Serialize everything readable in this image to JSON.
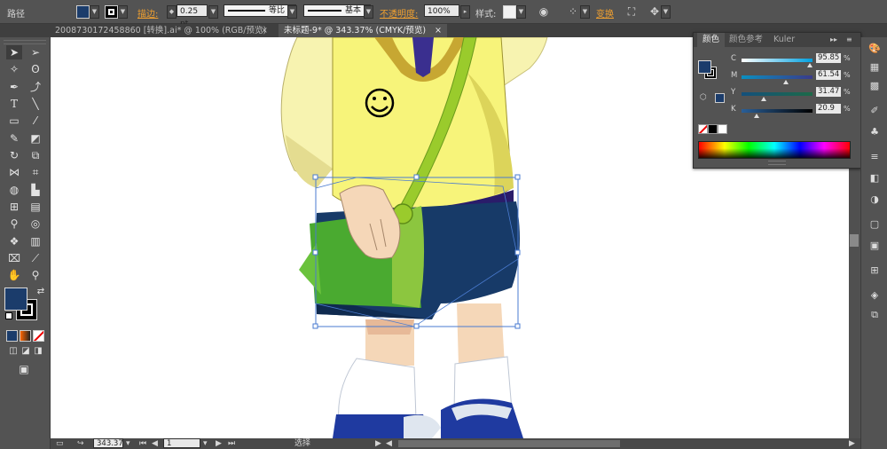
{
  "control_bar": {
    "mode_label": "路径",
    "stroke_label": "描边:",
    "stroke_weight": "0.25 pt",
    "profile_label": "等比",
    "brush_label": "基本",
    "opacity_label": "不透明度:",
    "opacity_value": "100%",
    "style_label": "样式:",
    "transform_label": "变换",
    "fill_color": "#1b3c6b",
    "stroke_color": "#000000"
  },
  "tabs": [
    {
      "label": "2008730172458860 [转换].ai* @ 100% (RGB/预览)",
      "close": "×"
    },
    {
      "label": "未标题-9* @ 343.37% (CMYK/预览)",
      "close": "×"
    }
  ],
  "color_panel": {
    "tabs": [
      "颜色",
      "颜色参考",
      "Kuler"
    ],
    "menu": "▸▸",
    "channels": [
      {
        "label": "C",
        "value": "95.85",
        "unit": "%",
        "fraction": 0.96
      },
      {
        "label": "M",
        "value": "61.54",
        "unit": "%",
        "fraction": 0.62
      },
      {
        "label": "Y",
        "value": "31.47",
        "unit": "%",
        "fraction": 0.31
      },
      {
        "label": "K",
        "value": "20.9",
        "unit": "%",
        "fraction": 0.21
      }
    ]
  },
  "status_bar": {
    "zoom": "343.37",
    "page": "1",
    "tool_status": "选择"
  },
  "colors": {
    "shirt": "#f7f47a",
    "shirt_shadow": "#d9d255",
    "sleeve": "#f7f3b0",
    "shorts": "#173a68",
    "bag": "#4aaa30",
    "strap": "#9acb2c",
    "skin": "#f5d7b8",
    "shoe": "#1f3aa0",
    "selection": "#4a7bd0"
  }
}
